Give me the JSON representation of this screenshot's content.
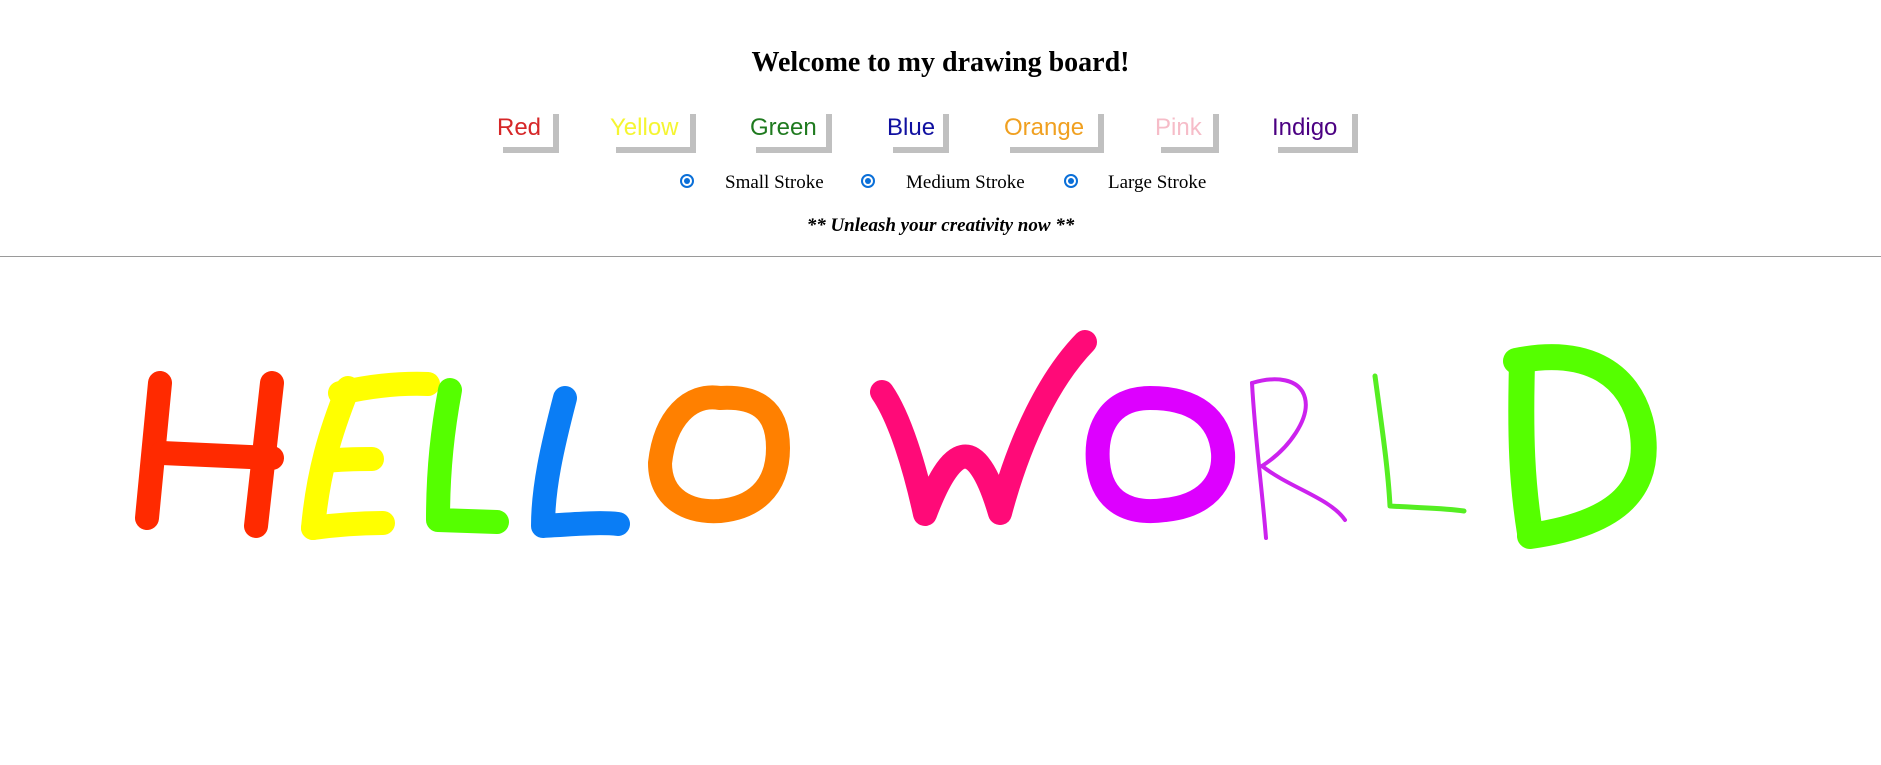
{
  "title": "Welcome to my drawing board!",
  "colors": [
    {
      "label": "Red",
      "color": "#d62728"
    },
    {
      "label": "Yellow",
      "color": "#f5f531"
    },
    {
      "label": "Green",
      "color": "#1f7a1f"
    },
    {
      "label": "Blue",
      "color": "#1010a0"
    },
    {
      "label": "Orange",
      "color": "#f0a020"
    },
    {
      "label": "Pink",
      "color": "#f6bcc8"
    },
    {
      "label": "Indigo",
      "color": "#4b0082"
    }
  ],
  "strokes": [
    {
      "label": "Small Stroke",
      "selected": true
    },
    {
      "label": "Medium Stroke",
      "selected": true
    },
    {
      "label": "Large Stroke",
      "selected": true
    }
  ],
  "tagline": "** Unleash your creativity now **",
  "drawing": {
    "text": "HELLO WORLD",
    "ink_colors": {
      "H": "#ff2a00",
      "E": "#ffff00",
      "L1": "#55ff00",
      "L2": "#0a7df5",
      "O1": "#ff8000",
      "W": "#ff0a78",
      "O2": "#dd00ff",
      "R": "#cc22ee",
      "L3": "#55ee22",
      "D": "#55ff00"
    }
  }
}
